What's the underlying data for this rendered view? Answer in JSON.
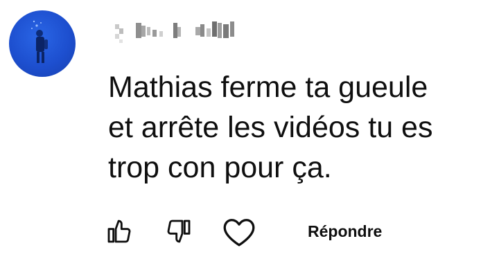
{
  "comment": {
    "author_redacted": true,
    "text": "Mathias ferme ta gueule\net arrête les vidéos tu es\ntrop con pour ça."
  },
  "actions": {
    "reply_label": "Répondre"
  },
  "icons": {
    "like": "thumbs-up-icon",
    "dislike": "thumbs-down-icon",
    "heart": "heart-icon"
  },
  "colors": {
    "avatar_bg": "#1d4fcf",
    "text": "#0f0f0f",
    "background": "#ffffff"
  }
}
